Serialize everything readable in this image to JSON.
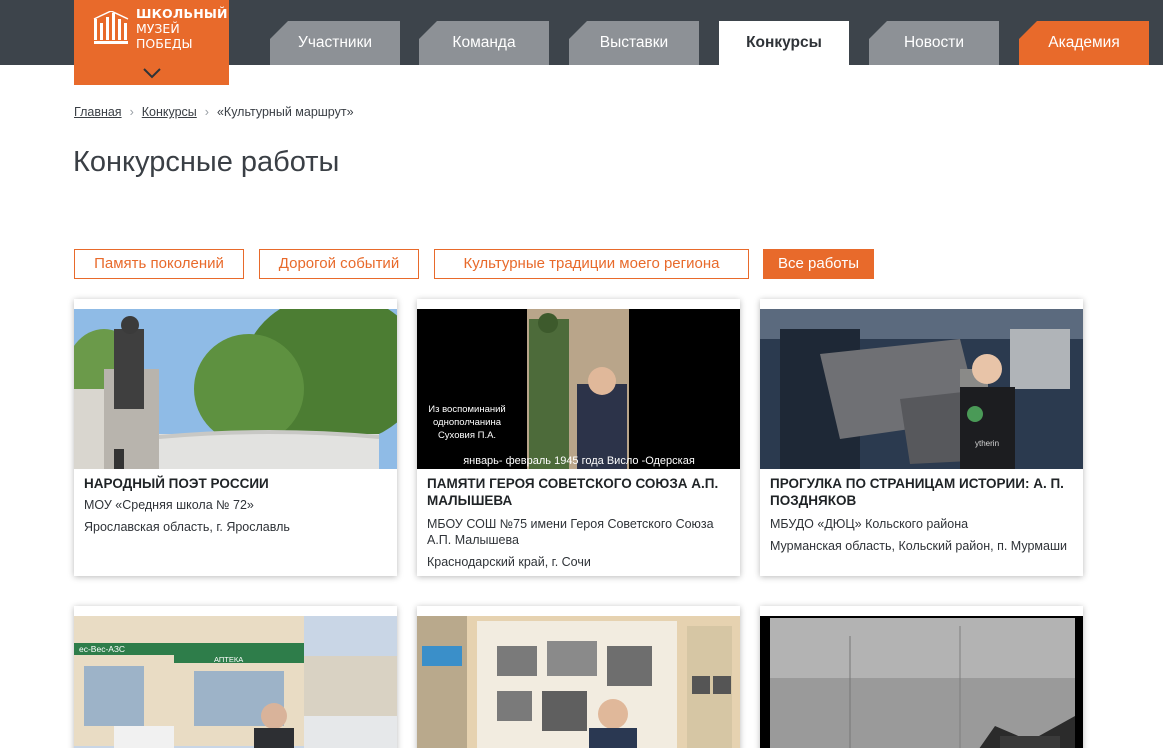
{
  "logo": {
    "line1": "ШКОЛЬНЫЙ",
    "line2": "МУЗЕЙ",
    "line3": "ПОБЕДЫ"
  },
  "nav": [
    {
      "label": "Участники"
    },
    {
      "label": "Команда"
    },
    {
      "label": "Выставки"
    },
    {
      "label": "Конкурсы",
      "active": true
    },
    {
      "label": "Новости"
    },
    {
      "label": "Академия"
    }
  ],
  "breadcrumb": {
    "home": "Главная",
    "section": "Конкурсы",
    "current": "«Культурный маршрут»"
  },
  "page_title": "Конкурсные работы",
  "filters": [
    {
      "label": "Память поколений"
    },
    {
      "label": "Дорогой событий"
    },
    {
      "label": "Культурные традиции моего региона"
    },
    {
      "label": "Все работы",
      "active": true
    }
  ],
  "cards": [
    {
      "title": "НАРОДНЫЙ ПОЭТ РОССИИ",
      "org": "МОУ «Средняя школа № 72»",
      "location": "Ярославская область, г. Ярославль"
    },
    {
      "title": "ПАМЯТИ ГЕРОЯ СОВЕТСКОГО СОЮЗА А.П. МАЛЫШЕВА",
      "org": "МБОУ СОШ №75 имени Героя Советского Союза А.П. Малышева",
      "location": "Краснодарский край, г. Сочи",
      "caption1": "Из воспоминаний однополчанина Суховия П.А.",
      "caption2": "январь- февраль 1945 года Висло -Одерская"
    },
    {
      "title": "ПРОГУЛКА ПО СТРАНИЦАМ ИСТОРИИ: А. П. ПОЗДНЯКОВ",
      "org": "МБУДО «ДЮЦ» Кольского района",
      "location": "Мурманская область, Кольский район, п. Мурмаши"
    },
    {
      "title": "",
      "org": "",
      "location": "",
      "sign1": "ес-Вес-АЗС",
      "sign2": "АПТЕКА"
    },
    {
      "title": "",
      "org": "",
      "location": ""
    },
    {
      "title": "",
      "org": "",
      "location": ""
    }
  ],
  "colors": {
    "accent": "#e86a2b",
    "topbar": "#3d444b",
    "tab_inactive": "#8d9196"
  }
}
